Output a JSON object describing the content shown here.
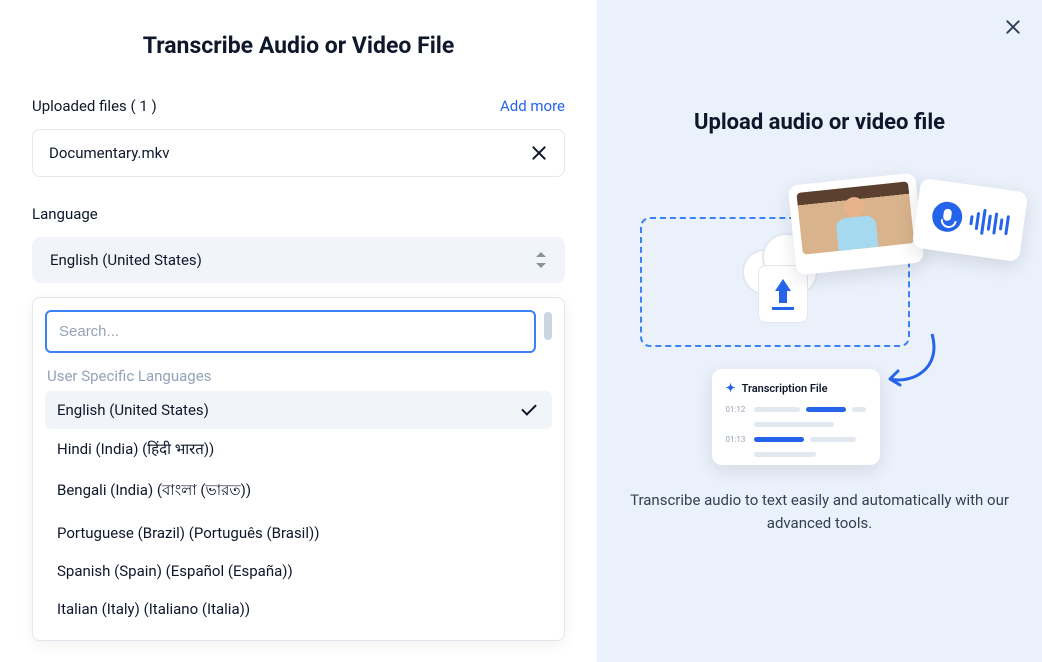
{
  "left": {
    "title": "Transcribe Audio or Video File",
    "uploaded_label": "Uploaded files ( 1 )",
    "add_more": "Add more",
    "file_name": "Documentary.mkv",
    "language_label": "Language",
    "selected_language": "English (United States)",
    "search_placeholder": "Search...",
    "group_label": "User Specific Languages",
    "options": [
      "English (United States)",
      "Hindi (India) (हिंदी भारत))",
      "Bengali (India) (বাংলা (ভারত))",
      "Portuguese (Brazil) (Português (Brasil))",
      "Spanish (Spain) (Español (España))",
      "Italian (Italy) (Italiano (Italia))"
    ]
  },
  "right": {
    "title": "Upload audio or video file",
    "trans_file_label": "Transcription File",
    "ts1": "01:12",
    "ts2": "01:13",
    "description": "Transcribe audio to text easily and automatically with our advanced tools."
  }
}
